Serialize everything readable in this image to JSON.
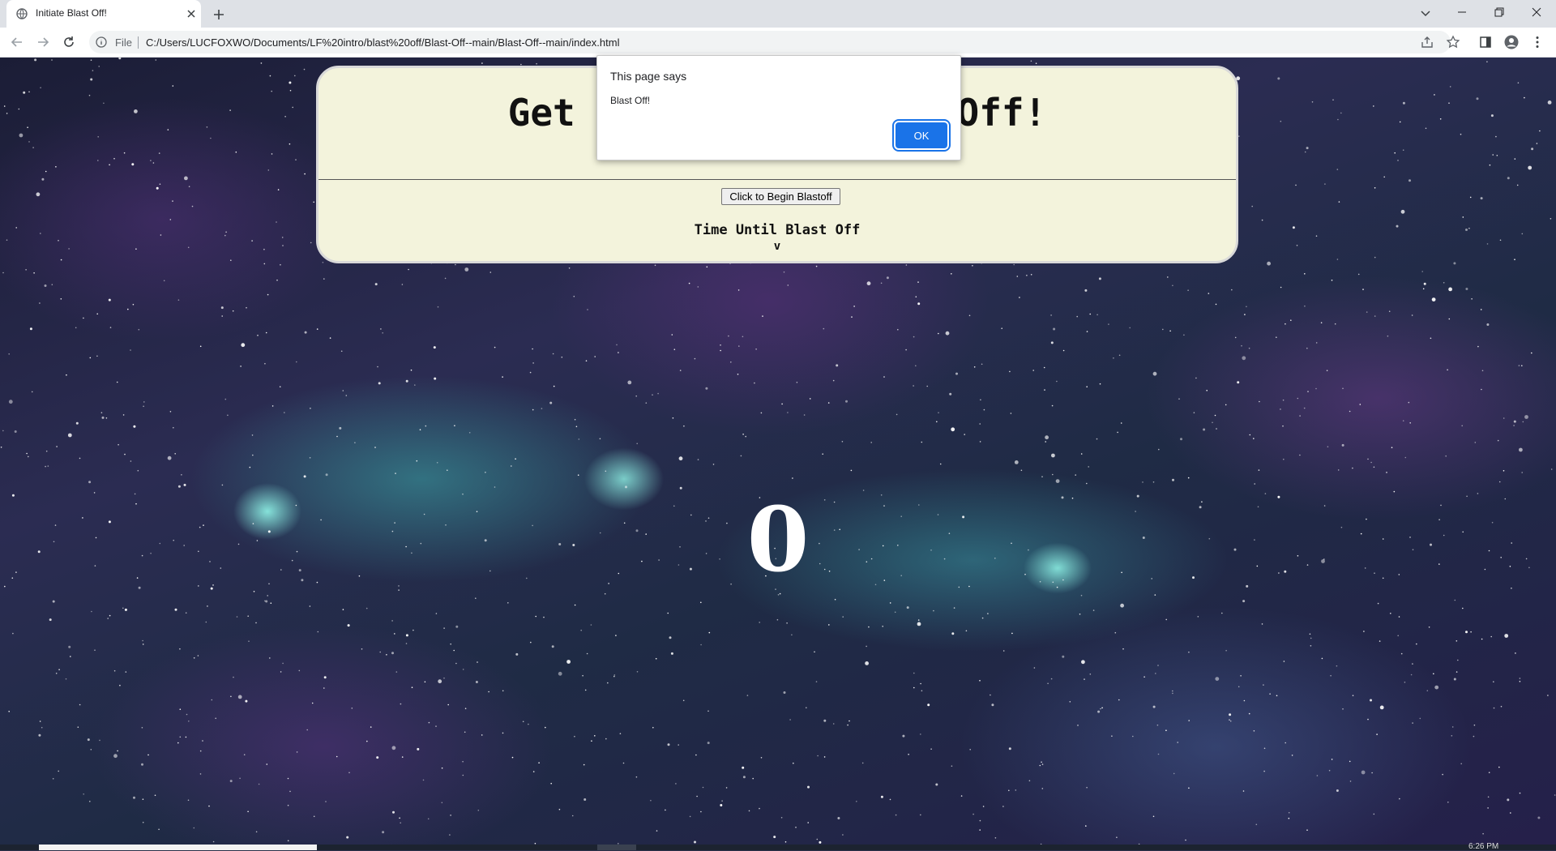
{
  "browser": {
    "tab_title": "Initiate Blast Off!",
    "address_scheme": "File",
    "address_url": "C:/Users/LUCFOXWO/Documents/LF%20intro/blast%20off/Blast-Off--main/Blast-Off--main/index.html"
  },
  "page": {
    "heading": "Get Ready for Blast Off!",
    "begin_button": "Click to Begin Blastoff",
    "time_label": "Time Until Blast Off",
    "arrow_label": "v",
    "countdown_value": "0"
  },
  "alert": {
    "title": "This page says",
    "message": "Blast Off!",
    "ok_label": "OK"
  },
  "taskbar": {
    "clock": "6:26 PM"
  }
}
